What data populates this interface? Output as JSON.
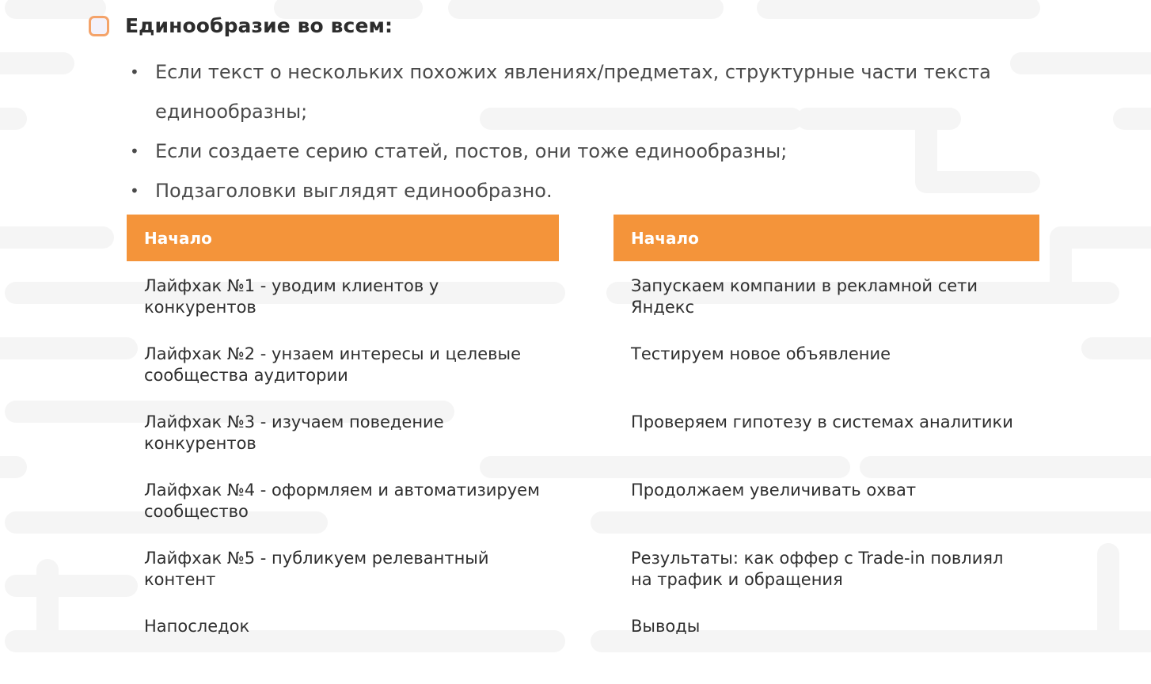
{
  "section": {
    "heading": "Единообразие во всем:",
    "bullets": [
      "Если текст о нескольких похожих явлениях/предметах, структурные части текста единообразны;",
      "Если создаете серию статей, постов, они тоже единообразны;",
      "Подзаголовки выглядят единообразно."
    ]
  },
  "toc_left": {
    "header": "Начало",
    "items": [
      "Лайфхак №1 - уводим клиентов у конкурентов",
      "Лайфхак №2 - унзаем интересы и целевые сообщества аудитории",
      "Лайфхак №3 - изучаем поведение конкурентов",
      "Лайфхак №4 - оформляем и автоматизируем сообщество",
      "Лайфхак №5 - публикуем релевантный контент",
      "Напоследок"
    ]
  },
  "toc_right": {
    "header": "Начало",
    "items": [
      "Запускаем компании в рекламной сети Яндекс",
      "Тестируем новое объявление",
      "Проверяем гипотезу в системах аналитики",
      "Продолжаем увеличивать охват",
      "Результаты: как оффер с Trade-in повлиял на трафик и обращения",
      "Выводы"
    ]
  },
  "colors": {
    "accent": "#f4943a",
    "checkbox_border": "#f4a36a",
    "pattern": "#f6f6f6"
  }
}
